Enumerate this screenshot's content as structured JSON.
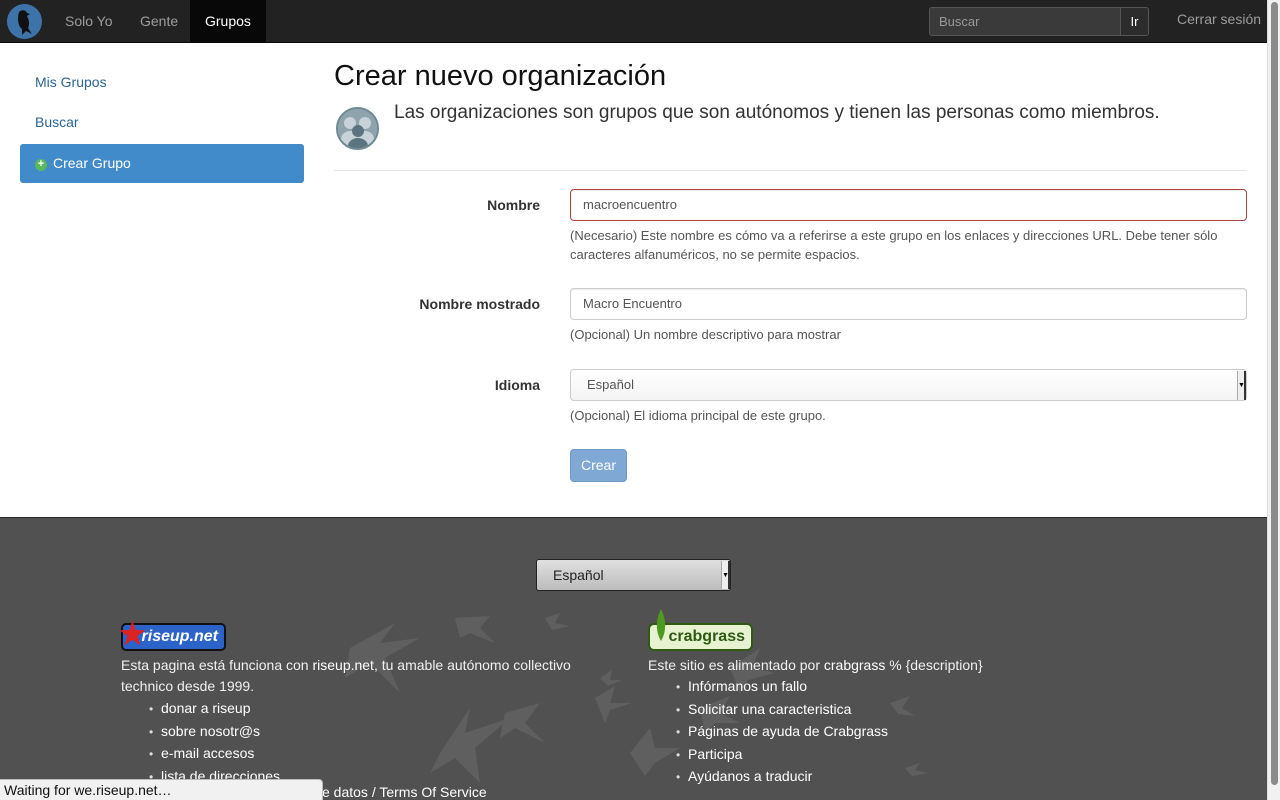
{
  "navbar": {
    "items": [
      {
        "label": "Solo Yo",
        "active": false
      },
      {
        "label": "Gente",
        "active": false
      },
      {
        "label": "Grupos",
        "active": true
      }
    ],
    "search_placeholder": "Buscar",
    "go_label": "Ir",
    "logout_label": "Cerrar sesión"
  },
  "sidebar": {
    "items": [
      {
        "label": "Mis Grupos"
      },
      {
        "label": "Buscar"
      },
      {
        "label": "Crear Grupo",
        "active": true,
        "icon": "plus-circle-icon"
      }
    ]
  },
  "main": {
    "title": "Crear nuevo organización",
    "description": "Las organizaciones son grupos que son autónomos y tienen las personas como miembros.",
    "fields": {
      "name": {
        "label": "Nombre",
        "value": "macroencuentro",
        "help": "(Necesario) Este nombre es cómo va a referirse a este grupo en los enlaces y direcciones URL. Debe tener sólo caracteres alfanuméricos, no se permite espacios."
      },
      "display_name": {
        "label": "Nombre mostrado",
        "value": "Macro Encuentro",
        "help": "(Opcional) Un nombre descriptivo para mostrar"
      },
      "language": {
        "label": "Idioma",
        "value": "Español",
        "help": "(Opcional) El idioma principal de este grupo."
      }
    },
    "submit_label": "Crear"
  },
  "footer": {
    "language_value": "Español",
    "riseup": {
      "logo_text": "riseup.net",
      "text_before": "Esta pagina está funciona con ",
      "link": "riseup.net",
      "text_after": ", tu amable autónomo collectivo technico desde 1999.",
      "links": [
        "donar a riseup",
        "sobre nosotr@s",
        "e-mail accesos",
        "lista de direcciones"
      ]
    },
    "crabgrass": {
      "logo_text": "crabgrass",
      "text_before": "Este sitio es alimentado por ",
      "link": "crabgrass",
      "text_after": " % {description}",
      "links": [
        "Infórmanos un fallo",
        "Solicitar una caracteristica",
        "Páginas de ayuda de Crabgrass",
        "Participa",
        "Ayúdanos a traducir"
      ]
    },
    "bottom_text": "e datos / Terms Of Service"
  },
  "status_bar": "Waiting for we.riseup.net…",
  "colors": {
    "navbar": "#222222",
    "primary": "#428bca",
    "error_border": "#a94442",
    "footer": "#515151"
  }
}
